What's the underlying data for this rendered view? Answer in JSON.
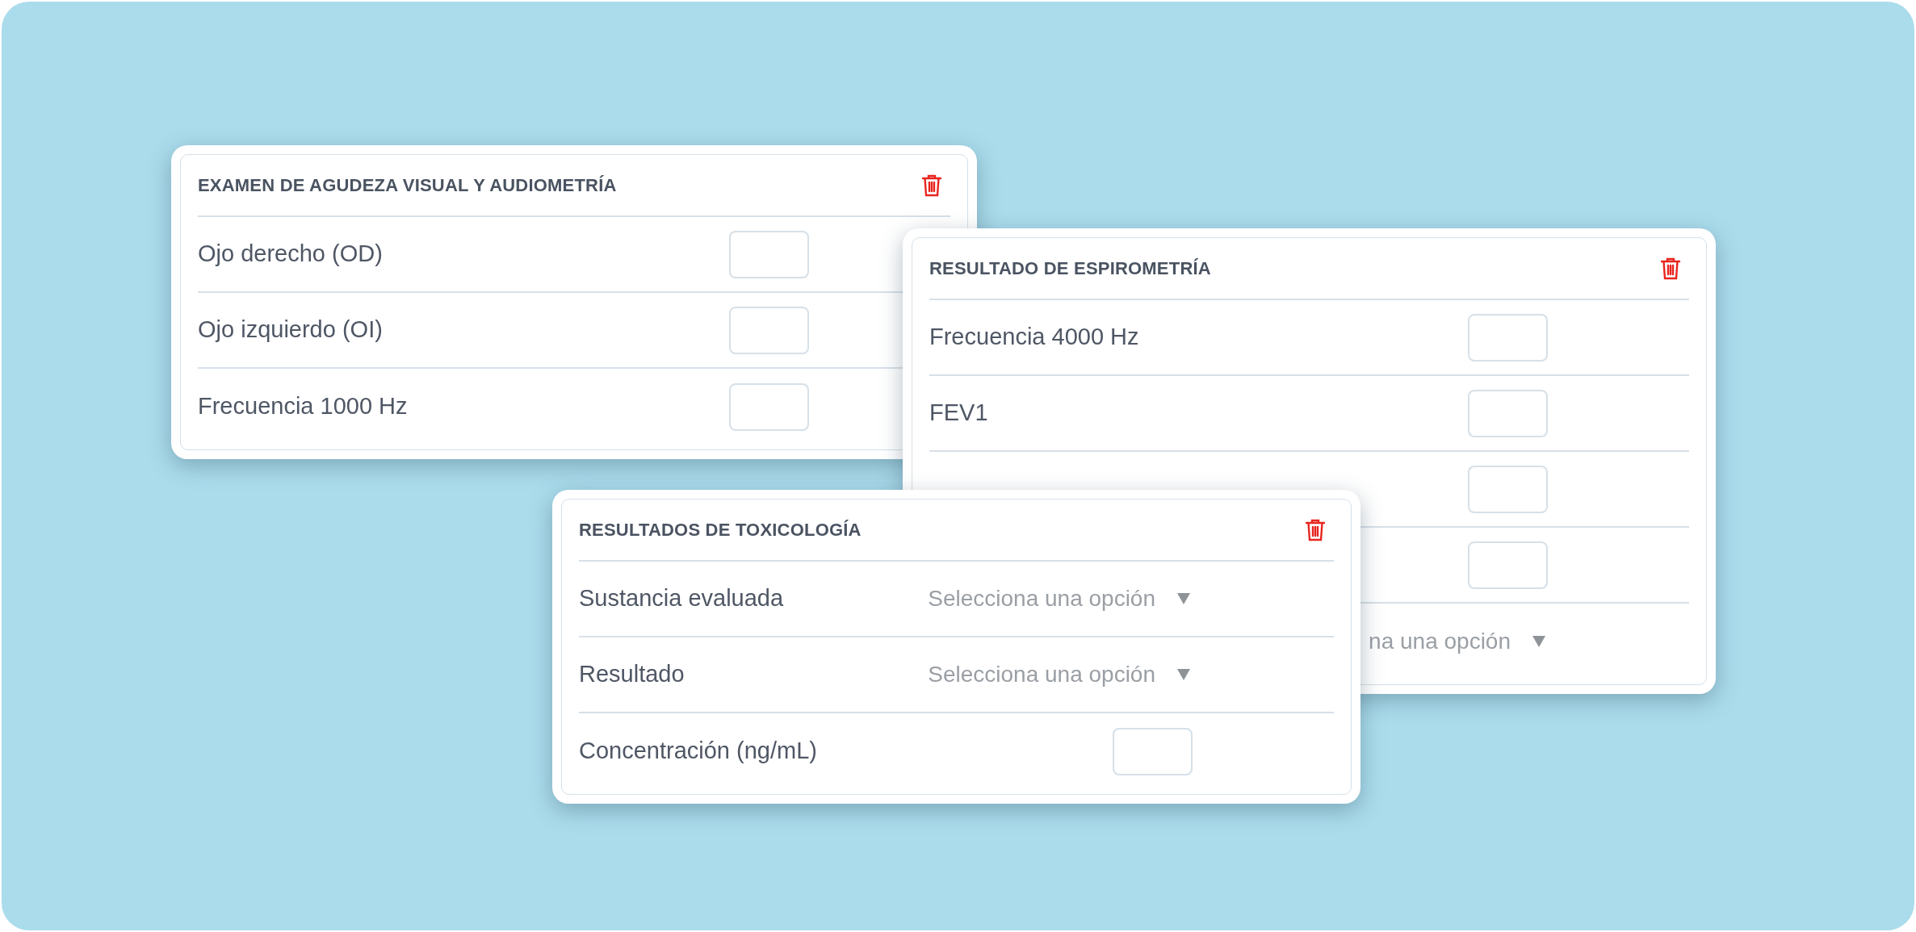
{
  "cards": [
    {
      "title": "EXAMEN DE AGUDEZA VISUAL Y AUDIOMETRÍA",
      "rows": [
        {
          "kind": "input",
          "label": "Ojo derecho (OD)"
        },
        {
          "kind": "input",
          "label": "Ojo izquierdo (OI)"
        },
        {
          "kind": "input",
          "label": "Frecuencia 1000 Hz"
        }
      ]
    },
    {
      "title": "RESULTADO DE ESPIROMETRÍA",
      "rows": [
        {
          "kind": "input",
          "label": "Frecuencia 4000 Hz"
        },
        {
          "kind": "input",
          "label": "FEV1"
        },
        {
          "kind": "input"
        },
        {
          "kind": "input"
        },
        {
          "kind": "select",
          "placeholder": "na una opción"
        }
      ]
    },
    {
      "title": "RESULTADOS DE TOXICOLOGÍA",
      "rows": [
        {
          "kind": "select",
          "label": "Sustancia evaluada",
          "placeholder": "Selecciona una opción"
        },
        {
          "kind": "select",
          "label": "Resultado",
          "placeholder": "Selecciona una opción"
        },
        {
          "kind": "input",
          "label": "Concentración (ng/mL)"
        }
      ]
    }
  ]
}
